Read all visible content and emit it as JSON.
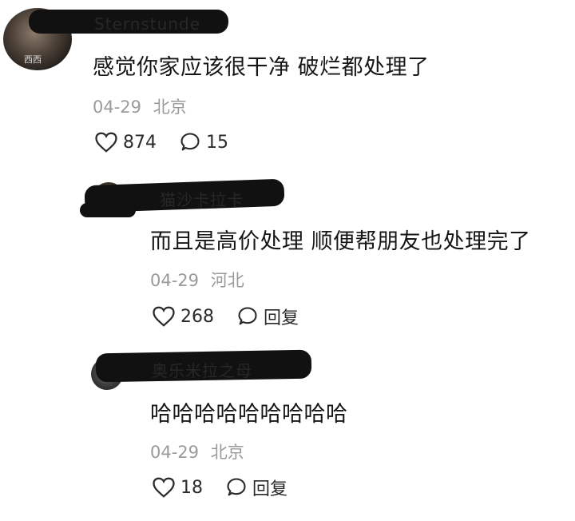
{
  "comments": [
    {
      "username": "Sternstunde",
      "avatar_text": "西西",
      "text": "感觉你家应该很干净 破烂都处理了",
      "date": "04-29",
      "location": "北京",
      "likes": "874",
      "reply_label": "15"
    },
    {
      "username": "猫沙卡拉卡",
      "text": "而且是高价处理 顺便帮朋友也处理完了",
      "date": "04-29",
      "location": "河北",
      "likes": "268",
      "reply_label": "回复"
    },
    {
      "username": "奥乐米拉之母",
      "text": "哈哈哈哈哈哈哈哈哈",
      "date": "04-29",
      "location": "北京",
      "likes": "18",
      "reply_label": "回复"
    }
  ],
  "icons": {
    "like": "heart-outline-icon",
    "comment": "speech-bubble-icon"
  }
}
